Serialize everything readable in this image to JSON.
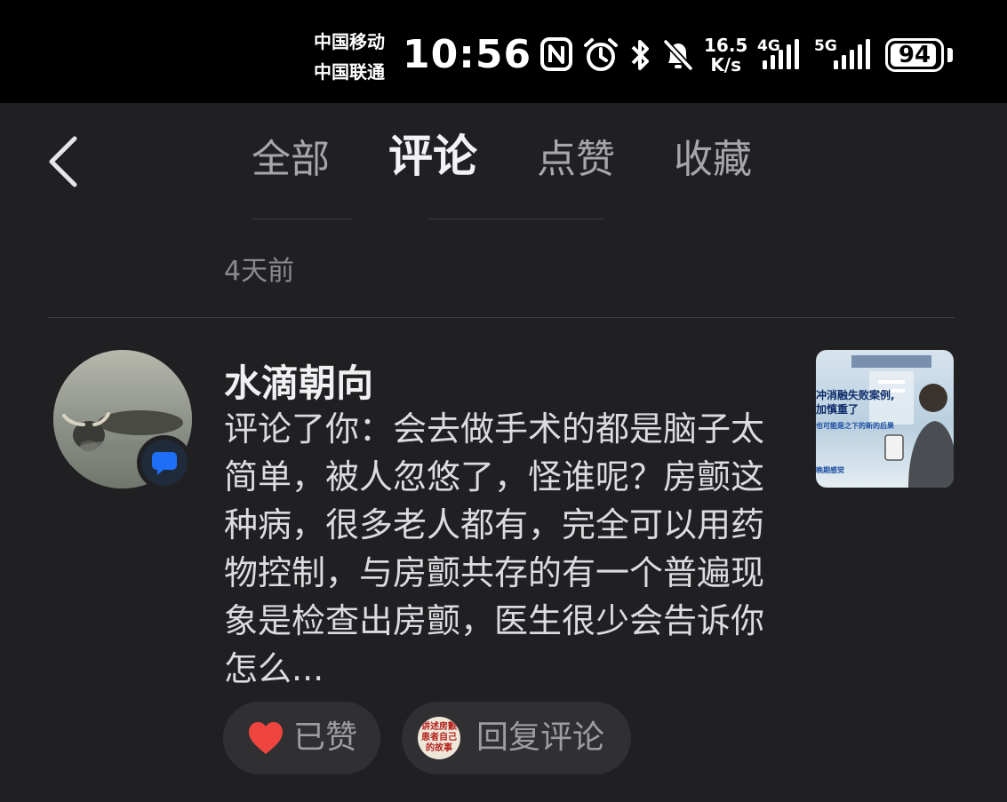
{
  "status_bar": {
    "carrier_1": "中国移动",
    "carrier_2": "中国联通",
    "time": "10:56",
    "speed_value": "16.5",
    "speed_unit": "K/s",
    "network_1": "4G",
    "network_2": "5G",
    "battery": "94",
    "battery_fraction": 0.94,
    "icons": [
      "nfc-icon",
      "alarm-icon",
      "bluetooth-icon",
      "mute-icon",
      "signal-icon",
      "signal-icon",
      "battery-icon"
    ]
  },
  "header": {
    "back_icon": "chevron-left-icon",
    "tabs": [
      {
        "label": "全部",
        "active": false
      },
      {
        "label": "评论",
        "active": true
      },
      {
        "label": "点赞",
        "active": false
      },
      {
        "label": "收藏",
        "active": false
      }
    ]
  },
  "previous_item": {
    "time": "4天前"
  },
  "notification": {
    "username": "水滴朝向",
    "comment": "评论了你：会去做手术的都是脑子太简单，被人忽悠了，怪谁呢？房颤这种病，很多老人都有，完全可以用药物控制，与房颤共存的有一个普遍现象是检查出房颤，医生很少会告诉你怎么...",
    "badge_icon": "comment-icon",
    "thumbnail_lines": [
      "冲消融失败案例,",
      "加慎重了",
      "也可能是之下的新的后果",
      "晚期感觉"
    ],
    "like_button": {
      "label": "已赞",
      "icon": "heart-icon",
      "color": "#f0453f"
    },
    "reply_button": {
      "label": "回复评论",
      "thumb_lines": [
        "讲述房颤",
        "患者自己",
        "的故事"
      ]
    }
  },
  "colors": {
    "background": "#202022",
    "status_bar": "#000000",
    "pill": "#303033",
    "heart": "#f0453f",
    "badge": "#1e6ff5"
  }
}
